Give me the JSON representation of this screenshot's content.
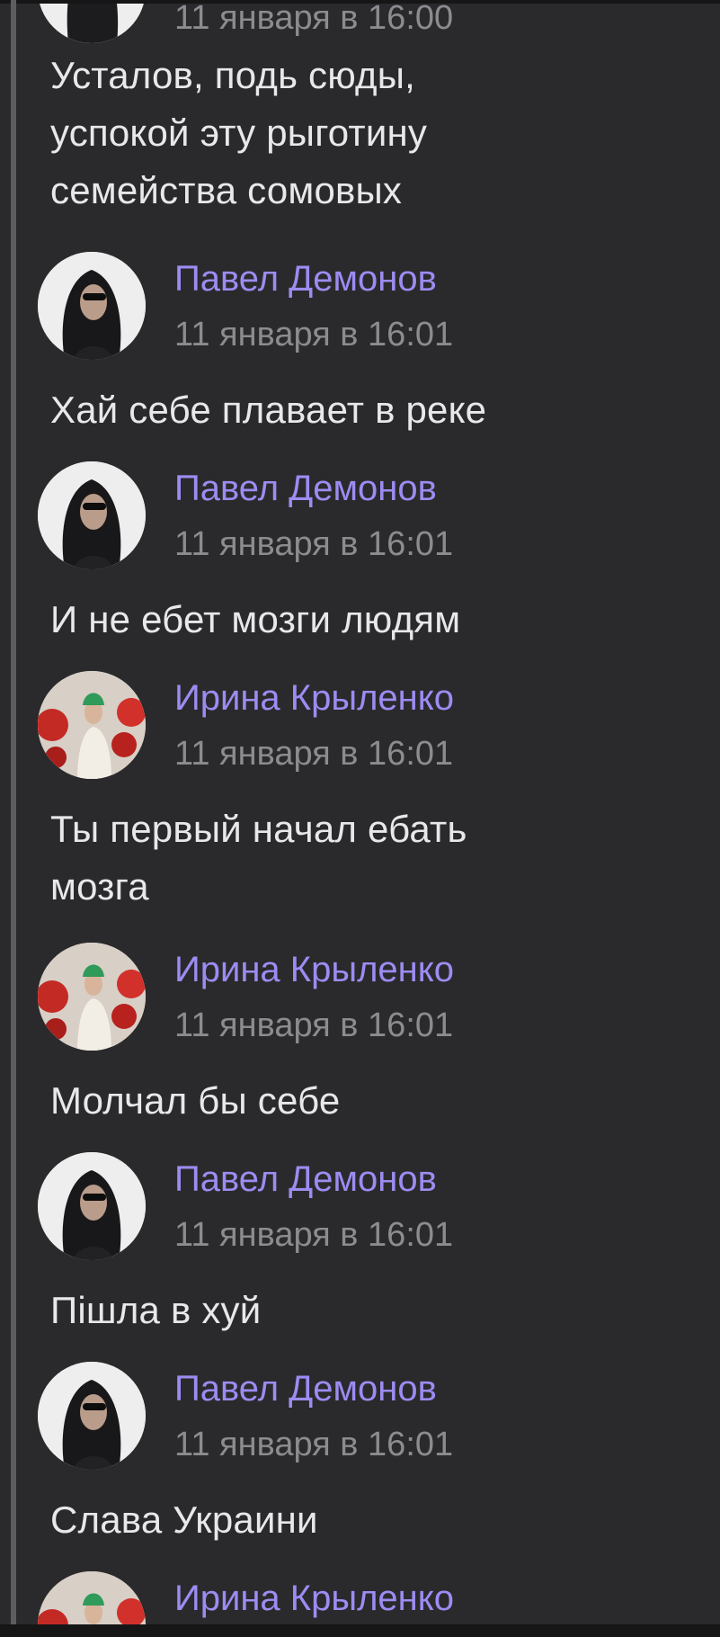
{
  "top_partial": {
    "timestamp": "11 января в 16:00",
    "text": [
      "Усталов, подь сюды,",
      "успокой эту рыготину",
      "семейства сомовых"
    ]
  },
  "messages": [
    {
      "author": "Павел Демонов",
      "avatar": "avatar-pavel",
      "timestamp": "11 января в 16:01",
      "text": [
        "Хай себе плавает в реке"
      ]
    },
    {
      "author": "Павел Демонов",
      "avatar": "avatar-pavel",
      "timestamp": "11 января в 16:01",
      "text": [
        "И не ебет мозги людям"
      ]
    },
    {
      "author": "Ирина Крыленко",
      "avatar": "avatar-irina",
      "timestamp": "11 января в 16:01",
      "text": [
        "Ты первый начал ебать",
        "мозга"
      ]
    },
    {
      "author": "Ирина Крыленко",
      "avatar": "avatar-irina",
      "timestamp": "11 января в 16:01",
      "text": [
        "Молчал бы себе"
      ]
    },
    {
      "author": "Павел Демонов",
      "avatar": "avatar-pavel",
      "timestamp": "11 января в 16:01",
      "text": [
        "Пішла в хуй"
      ]
    },
    {
      "author": "Павел Демонов",
      "avatar": "avatar-pavel",
      "timestamp": "11 января в 16:01",
      "text": [
        "Слава Украини"
      ]
    }
  ],
  "bottom_partial": {
    "author": "Ирина Крыленко"
  },
  "colors": {
    "background": "#2a2a2c",
    "author_name": "#9c8cf2",
    "timestamp": "#8c8c90",
    "message_text": "#e8e8ea"
  }
}
